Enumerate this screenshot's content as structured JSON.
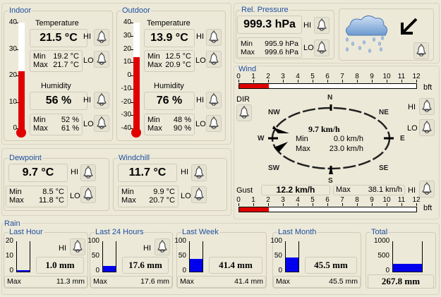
{
  "indoor": {
    "title": "Indoor",
    "scale": [
      "40",
      "30",
      "20",
      "10",
      "0"
    ],
    "scale_min": 0,
    "scale_max": 40,
    "temperature": {
      "label": "Temperature",
      "value": "21.5 °C",
      "num": 21.5,
      "min_label": "Min",
      "min": "19.2 °C",
      "max_label": "Max",
      "max": "21.7 °C"
    },
    "humidity": {
      "label": "Humidity",
      "value": "56 %",
      "min_label": "Min",
      "min": "52 %",
      "max_label": "Max",
      "max": "61 %"
    }
  },
  "outdoor": {
    "title": "Outdoor",
    "scale": [
      "40",
      "30",
      "20",
      "10",
      "0",
      "-10",
      "-20",
      "-30",
      "-40"
    ],
    "scale_min": -40,
    "scale_max": 40,
    "temperature": {
      "label": "Temperature",
      "value": "13.9 °C",
      "num": 13.9,
      "min_label": "Min",
      "min": "12.5 °C",
      "max_label": "Max",
      "max": "20.9 °C"
    },
    "humidity": {
      "label": "Humidity",
      "value": "76 %",
      "min_label": "Min",
      "min": "48 %",
      "max_label": "Max",
      "max": "90 %"
    }
  },
  "dewpoint": {
    "title": "Dewpoint",
    "value": "9.7 °C",
    "min_label": "Min",
    "min": "8.5 °C",
    "max_label": "Max",
    "max": "11.8 °C"
  },
  "windchill": {
    "title": "Windchill",
    "value": "11.7 °C",
    "min_label": "Min",
    "min": "9.9 °C",
    "max_label": "Max",
    "max": "20.7 °C"
  },
  "pressure": {
    "title": "Rel. Pressure",
    "value": "999.3 hPa",
    "min_label": "Min",
    "min": "995.9 hPa",
    "max_label": "Max",
    "max": "999.6 hPa"
  },
  "alarm": {
    "hi": "HI",
    "lo": "LO",
    "dir": "DIR"
  },
  "wind": {
    "title": "Wind",
    "bft_ticks": [
      "0",
      "1",
      "2",
      "3",
      "4",
      "5",
      "6",
      "7",
      "8",
      "9",
      "10",
      "11",
      "12"
    ],
    "bft_unit": "bft",
    "bft_value": 2,
    "directions": {
      "n": "N",
      "ne": "NE",
      "e": "E",
      "se": "SE",
      "s": "S",
      "sw": "SW",
      "w": "W",
      "nw": "NW"
    },
    "speed": "9.7 km/h",
    "min_label": "Min",
    "min": "0.0 km/h",
    "max_label": "Max",
    "max": "23.0 km/h",
    "gust_label": "Gust",
    "gust": "12.2 km/h",
    "gust_max_label": "Max",
    "gust_max": "38.1 km/h",
    "gust_bft_value": 2
  },
  "rain": {
    "title": "Rain",
    "max_label": "Max",
    "groups": [
      {
        "title": "Last Hour",
        "scale": [
          "20",
          "10",
          "0"
        ],
        "scale_max": 20,
        "num": 1.0,
        "value": "1.0 mm",
        "max": "11.3 mm"
      },
      {
        "title": "Last 24 Hours",
        "scale": [
          "100",
          "50",
          "0"
        ],
        "scale_max": 100,
        "num": 17.6,
        "value": "17.6 mm",
        "max": "17.6 mm"
      },
      {
        "title": "Last Week",
        "scale": [
          "100",
          "50",
          "0"
        ],
        "scale_max": 100,
        "num": 41.4,
        "value": "41.4 mm",
        "max": "41.4 mm"
      },
      {
        "title": "Last Month",
        "scale": [
          "100",
          "50",
          "0"
        ],
        "scale_max": 100,
        "num": 45.5,
        "value": "45.5 mm",
        "max": "45.5 mm"
      },
      {
        "title": "Total",
        "scale": [
          "1000",
          "500",
          "0"
        ],
        "scale_max": 1000,
        "num": 267.8,
        "value": "267.8 mm"
      }
    ]
  }
}
